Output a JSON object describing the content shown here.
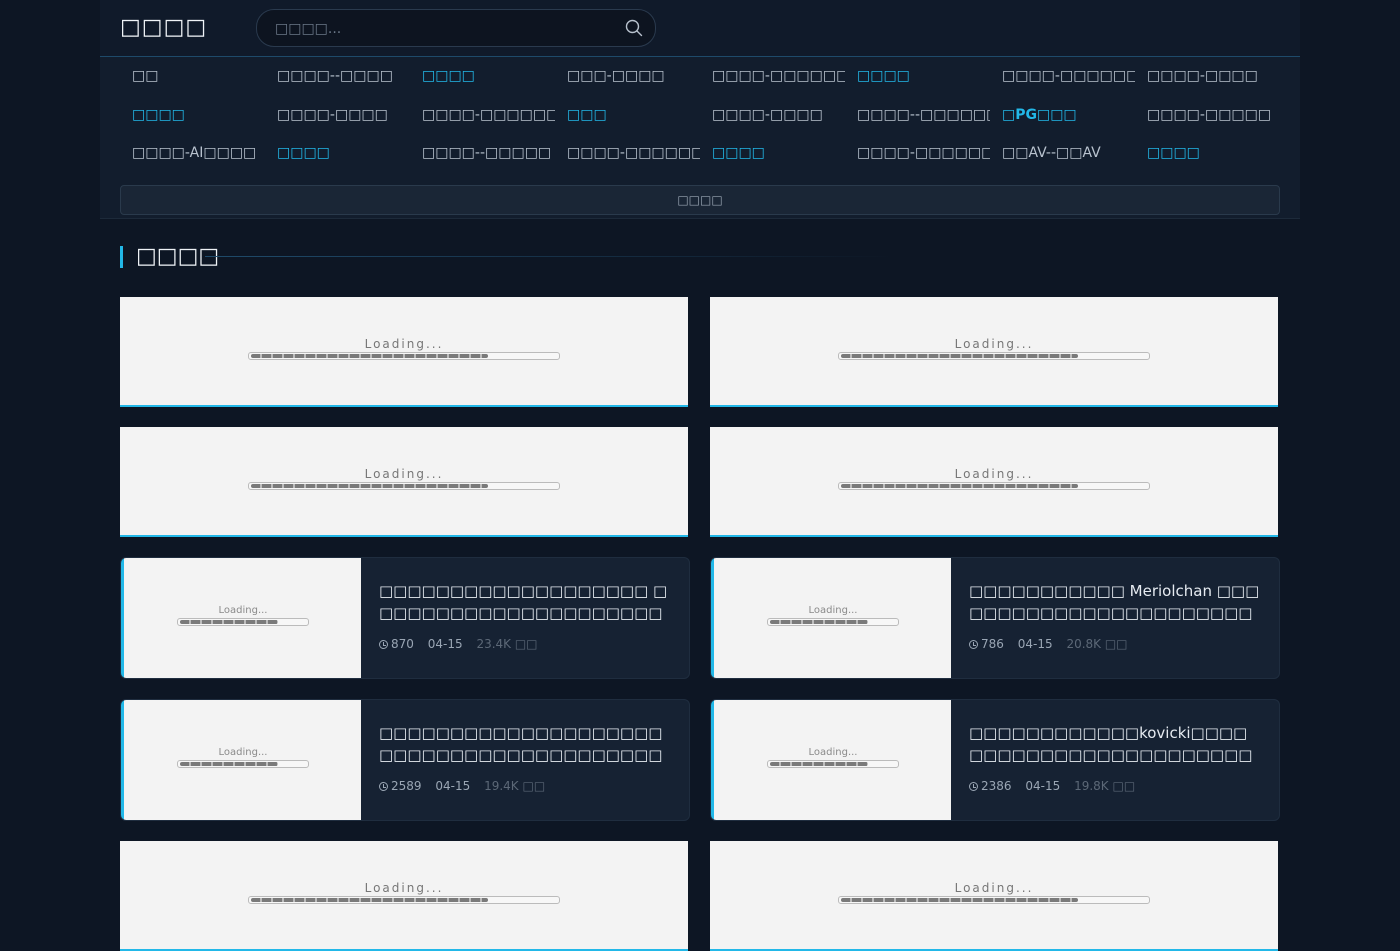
{
  "header": {
    "logo": "□□□□",
    "search_placeholder": "□□□□..."
  },
  "nav": {
    "items": [
      {
        "label": "□□",
        "highlight": false,
        "bold": false
      },
      {
        "label": "□□□□--□□□□",
        "highlight": false,
        "bold": false
      },
      {
        "label": "□□□□",
        "highlight": true,
        "bold": false
      },
      {
        "label": "□□□-□□□□",
        "highlight": false,
        "bold": false
      },
      {
        "label": "□□□□-□□□□□□□",
        "highlight": false,
        "bold": false
      },
      {
        "label": "□□□□",
        "highlight": true,
        "bold": false
      },
      {
        "label": "□□□□-□□□□□□□",
        "highlight": false,
        "bold": false
      },
      {
        "label": "□□□□-□□□□",
        "highlight": false,
        "bold": false
      },
      {
        "label": "□□□□",
        "highlight": true,
        "bold": false
      },
      {
        "label": "□□□□-□□□□",
        "highlight": false,
        "bold": false
      },
      {
        "label": "□□□□-□□□□□□□□",
        "highlight": false,
        "bold": false
      },
      {
        "label": "□□□",
        "highlight": true,
        "bold": false
      },
      {
        "label": "□□□□-□□□□",
        "highlight": false,
        "bold": false
      },
      {
        "label": "□□□□--□□□□□□□",
        "highlight": false,
        "bold": false
      },
      {
        "label": "□PG□□□",
        "highlight": true,
        "bold": true
      },
      {
        "label": "□□□□-□□□□□",
        "highlight": false,
        "bold": false
      },
      {
        "label": "□□□□-AI□□□□",
        "highlight": false,
        "bold": false
      },
      {
        "label": "□□□□",
        "highlight": true,
        "bold": false
      },
      {
        "label": "□□□□--□□□□□",
        "highlight": false,
        "bold": false
      },
      {
        "label": "□□□□-□□□□□□□□",
        "highlight": false,
        "bold": false
      },
      {
        "label": "□□□□",
        "highlight": true,
        "bold": false
      },
      {
        "label": "□□□□-□□□□□□□",
        "highlight": false,
        "bold": false
      },
      {
        "label": "□□AV--□□AV",
        "highlight": false,
        "bold": false
      },
      {
        "label": "□□□□",
        "highlight": true,
        "bold": false
      }
    ],
    "more_label": "□□□□"
  },
  "section": {
    "title": "□□□□"
  },
  "loading": {
    "big_text": "Loading...",
    "small_text": "Loading...",
    "progress": 0.77
  },
  "cards": [
    {
      "title": "□□□□□□□□□□□□□□□□□□□ □□□□□□□□□□□□□□□□□□□□□□□□□□□□□#□□□",
      "duration": "870",
      "date": "04-15",
      "views": "23.4K □□"
    },
    {
      "title": "□□□□□□□□□□□ Meriolchan □□□□□□□□□□□□□□□□□□□□□□□□□□□□#□□□",
      "duration": "786",
      "date": "04-15",
      "views": "20.8K □□"
    },
    {
      "title": "□□□□□□□□□□□□□□□□□□□□□□□□□□□□□□□□□□□□□□□□□□□□□□□□□□ □□□□□□□□□□#□□□",
      "duration": "2589",
      "date": "04-15",
      "views": "19.4K □□"
    },
    {
      "title": "□□□□□□□□□□□□kovicki□□□□□□□□□□□□□□□□□□□□□□□□□□□#□□□",
      "duration": "2386",
      "date": "04-15",
      "views": "19.8K □□"
    }
  ],
  "colors": {
    "accent": "#22b8e8",
    "background": "#0d1624",
    "card": "#162233"
  }
}
